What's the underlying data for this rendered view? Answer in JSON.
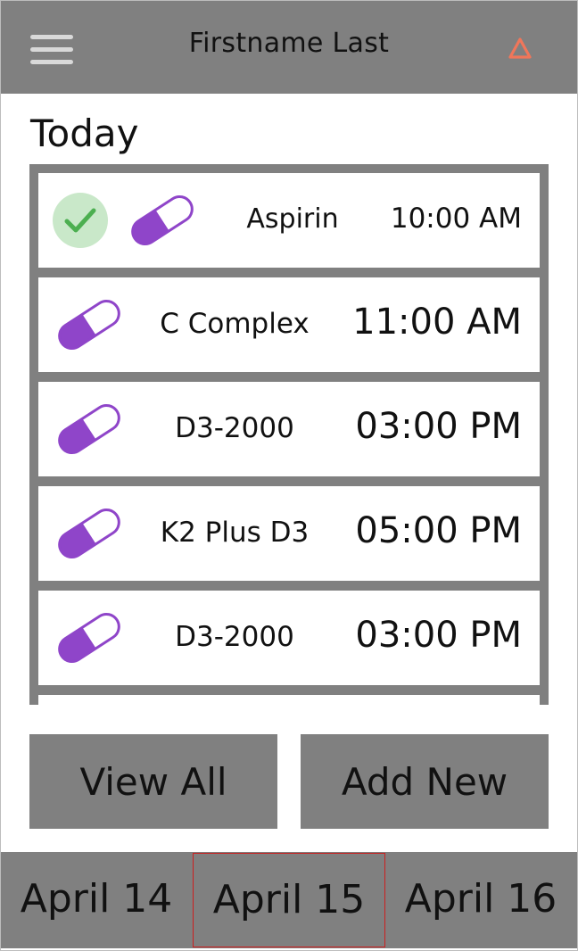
{
  "header": {
    "title": "Firstname Last",
    "menu_icon": "hamburger-menu-icon",
    "alert_icon": "warning-triangle-icon",
    "alert_color": "#f0765a"
  },
  "section_title": "Today",
  "medications": [
    {
      "name": "Aspirin",
      "time": "10:00 AM",
      "taken": true
    },
    {
      "name": "C Complex",
      "time": "11:00 AM",
      "taken": false
    },
    {
      "name": "D3-2000",
      "time": "03:00 PM",
      "taken": false
    },
    {
      "name": "K2 Plus D3",
      "time": "05:00 PM",
      "taken": false
    },
    {
      "name": "D3-2000",
      "time": "03:00 PM",
      "taken": false
    }
  ],
  "icons": {
    "pill": "pill-capsule-icon",
    "check": "checkmark-icon"
  },
  "colors": {
    "pill": "#8f45c9",
    "check_bg": "#c9e8c9",
    "check": "#4caf50",
    "panel": "#808080",
    "selected_border": "#cc1f1f"
  },
  "buttons": {
    "view_all": "View All",
    "add_new": "Add New"
  },
  "dates": {
    "prev": "April 14",
    "current": "April 15",
    "next": "April 16"
  }
}
